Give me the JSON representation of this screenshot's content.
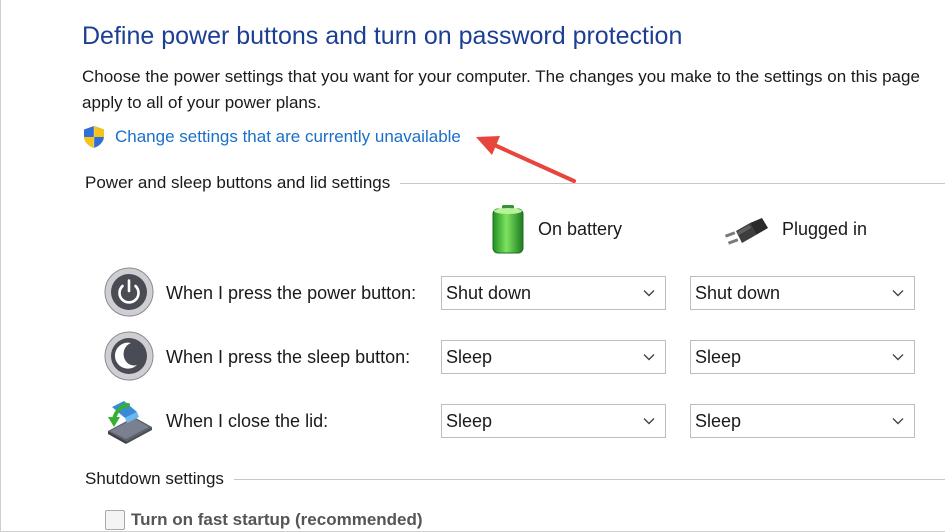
{
  "header": {
    "title": "Define power buttons and turn on password protection",
    "description": "Choose the power settings that you want for your computer. The changes you make to the settings on this page apply to all of your power plans."
  },
  "change_link": {
    "label": "Change settings that are currently unavailable",
    "icon": "uac-shield-icon"
  },
  "annotation": {
    "arrow_color": "#e8453c"
  },
  "power_section": {
    "heading": "Power and sleep buttons and lid settings",
    "columns": [
      {
        "label": "On battery",
        "icon": "battery-icon"
      },
      {
        "label": "Plugged in",
        "icon": "power-plug-icon"
      }
    ],
    "rows": [
      {
        "label": "When I press the power button:",
        "icon": "power-button-icon",
        "battery": "Shut down",
        "plugged": "Shut down"
      },
      {
        "label": "When I press the sleep button:",
        "icon": "sleep-button-icon",
        "battery": "Sleep",
        "plugged": "Sleep"
      },
      {
        "label": "When I close the lid:",
        "icon": "laptop-lid-icon",
        "battery": "Sleep",
        "plugged": "Sleep"
      }
    ]
  },
  "shutdown_section": {
    "heading": "Shutdown settings",
    "fast_startup_label": "Turn on fast startup (recommended)",
    "fast_startup_checked": false
  }
}
